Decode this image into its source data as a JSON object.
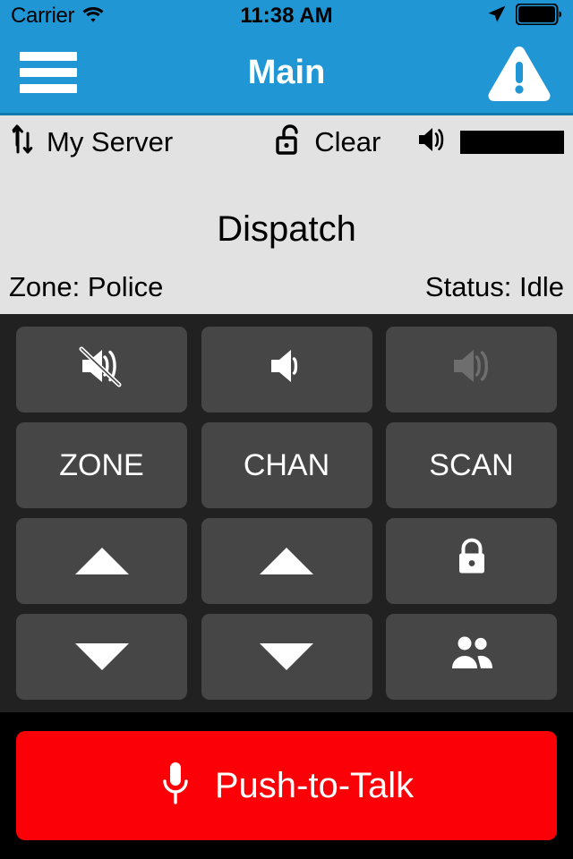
{
  "statusbar": {
    "carrier": "Carrier",
    "time": "11:38 AM",
    "wifi_icon": "wifi-icon",
    "location_icon": "location-arrow-icon",
    "battery_icon": "battery-full-icon"
  },
  "navbar": {
    "menu_icon": "hamburger-menu-icon",
    "title": "Main",
    "alert_icon": "warning-triangle-icon"
  },
  "toolbar": {
    "server_icon": "transfer-up-down-icon",
    "server_label": "My Server",
    "encryption_icon": "unlocked-padlock-icon",
    "encryption_label": "Clear",
    "volume_icon": "speaker-icon",
    "volume_level": 100
  },
  "info": {
    "title": "Dispatch",
    "zone": "Zone: Police",
    "status": "Status: Idle"
  },
  "keypad": {
    "rows": [
      [
        {
          "name": "mute-button",
          "icon": "speaker-mute-icon",
          "label": "",
          "disabled": false
        },
        {
          "name": "volume-down-button",
          "icon": "speaker-low-icon",
          "label": "",
          "disabled": false
        },
        {
          "name": "volume-up-button",
          "icon": "speaker-high-icon",
          "label": "",
          "disabled": true
        }
      ],
      [
        {
          "name": "zone-button",
          "icon": "",
          "label": "ZONE",
          "disabled": false
        },
        {
          "name": "chan-button",
          "icon": "",
          "label": "CHAN",
          "disabled": false
        },
        {
          "name": "scan-button",
          "icon": "",
          "label": "SCAN",
          "disabled": false
        }
      ],
      [
        {
          "name": "zone-up-button",
          "icon": "triangle-up-icon",
          "label": "",
          "disabled": false
        },
        {
          "name": "chan-up-button",
          "icon": "triangle-up-icon",
          "label": "",
          "disabled": false
        },
        {
          "name": "lock-button",
          "icon": "locked-padlock-icon",
          "label": "",
          "disabled": false
        }
      ],
      [
        {
          "name": "zone-down-button",
          "icon": "triangle-down-icon",
          "label": "",
          "disabled": false
        },
        {
          "name": "chan-down-button",
          "icon": "triangle-down-icon",
          "label": "",
          "disabled": false
        },
        {
          "name": "contacts-button",
          "icon": "people-group-icon",
          "label": "",
          "disabled": false
        }
      ]
    ]
  },
  "ptt": {
    "icon": "microphone-icon",
    "label": "Push-to-Talk"
  },
  "colors": {
    "accent_blue": "#2196d4",
    "ptt_red": "#fb0007",
    "key_fill": "#464646",
    "panel_dark": "#212121",
    "toolbar_gray": "#e2e2e2",
    "icon_disabled": "#6e6e6e"
  }
}
